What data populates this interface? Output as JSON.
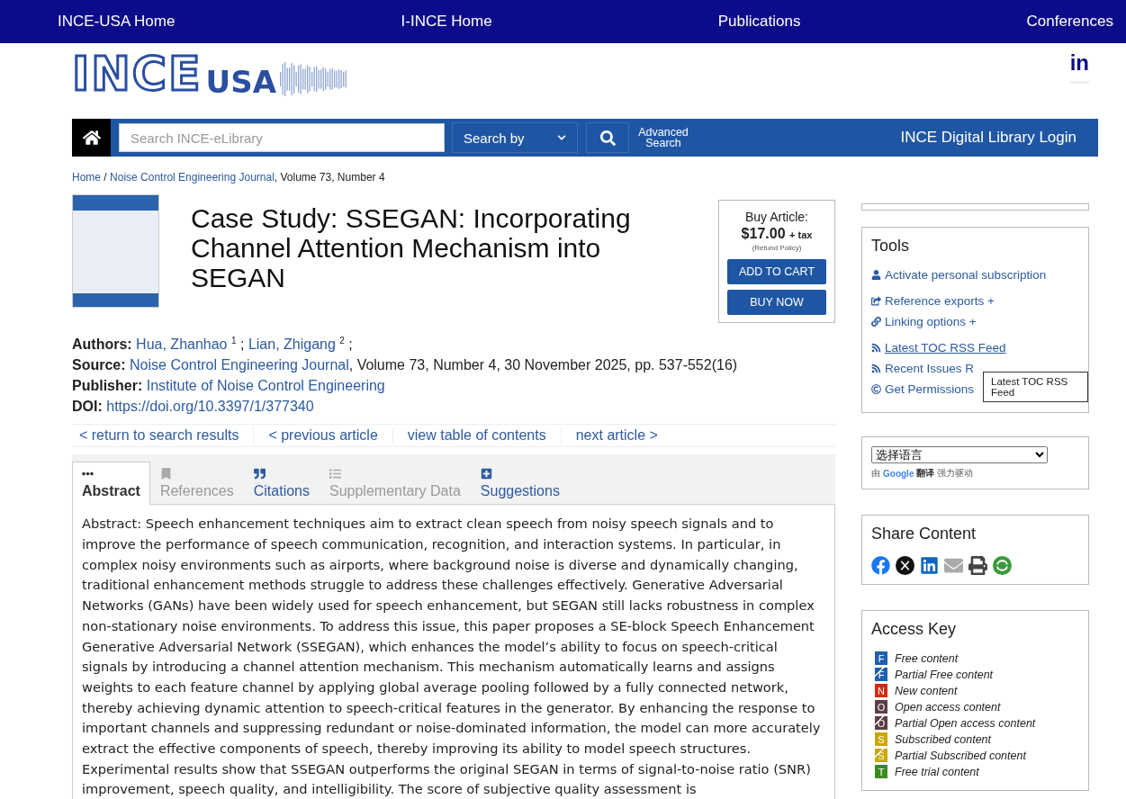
{
  "top_nav": [
    {
      "label": "INCE-USA Home"
    },
    {
      "label": "I-INCE Home"
    },
    {
      "label": "Publications"
    },
    {
      "label": "Conferences"
    }
  ],
  "logo": {
    "main": "INCE",
    "suffix": "USA"
  },
  "social_link": {
    "label": "in"
  },
  "search_bar": {
    "placeholder": "Search INCE-eLibrary",
    "search_by": "Search by",
    "advanced": "Advanced Search",
    "login": "INCE Digital Library Login"
  },
  "breadcrumb": {
    "home": "Home",
    "separator": "/",
    "journal": "Noise Control Engineering Journal",
    "rest": ", Volume 73, Number 4"
  },
  "article": {
    "title": "Case Study: SSEGAN: Incorporating Channel Attention Mechanism into SEGAN",
    "meta": [
      {
        "kind": "authors",
        "label": "Authors:",
        "parts": [
          {
            "text": "Hua, Zhanhao",
            "sup": "1"
          },
          {
            "text": "Lian, Zhigang",
            "sup": "2"
          }
        ],
        "tail": ";"
      },
      {
        "kind": "link",
        "label": "Source:",
        "link": "Noise Control Engineering Journal",
        "rest": ", Volume 73, Number 4, 30 November 2025, pp. 537-552(16)"
      },
      {
        "kind": "link",
        "label": "Publisher:",
        "link": "Institute of Noise Control Engineering"
      },
      {
        "kind": "link",
        "label": "DOI:",
        "link": "https://doi.org/10.3397/1/377340"
      }
    ]
  },
  "buy_box": {
    "title": "Buy Article:",
    "price": "$17.00",
    "tax": "+ tax",
    "refund": "(Refund Policy)",
    "buttons": [
      "ADD TO CART",
      "BUY NOW"
    ]
  },
  "article_nav": [
    {
      "label": "< return to search results"
    },
    {
      "label": "< previous article"
    },
    {
      "label": "view table of contents"
    },
    {
      "label": "next article >"
    }
  ],
  "tabs": [
    {
      "kind": "dots",
      "label": "Abstract",
      "selected": true,
      "disabled": false
    },
    {
      "kind": "bookmark",
      "label": "References",
      "selected": false,
      "disabled": true
    },
    {
      "kind": "quote",
      "label": "Citations",
      "selected": false,
      "disabled": false
    },
    {
      "kind": "list",
      "label": "Supplementary Data",
      "selected": false,
      "disabled": true
    },
    {
      "kind": "plus",
      "label": "Suggestions",
      "selected": false,
      "disabled": false
    }
  ],
  "abstract": "Abstract: Speech enhancement techniques aim to extract clean speech from noisy speech signals and to improve the performance of speech communication, recognition, and interaction systems. In particular, in complex noisy environments such as airports, where background noise is diverse and dynamically changing, traditional enhancement methods struggle to address these challenges effectively. Generative Adversarial Networks (GANs) have been widely used for speech enhancement, but SEGAN still lacks robustness in complex non-stationary noise environments. To address this issue, this paper proposes a SE-block Speech Enhancement Generative Adversarial Network (SSEGAN), which enhances the model’s ability to focus on speech-critical signals by introducing a channel attention mechanism. This mechanism automatically learns and assigns weights to each feature channel by applying global average pooling followed by a fully connected network, thereby achieving dynamic attention to speech-critical features in the generator. By enhancing the response to important channels and suppressing redundant or noise-dominated information, the model can more accurately extract the effective components of speech, thereby improving its ability to model speech structures. Experimental results show that SSEGAN outperforms the original SEGAN in terms of signal-to-noise ratio (SNR) improvement, speech quality, and intelligibility. The score of subjective quality assessment is",
  "tools": {
    "title": "Tools",
    "items": [
      {
        "kind": "user",
        "label": "Activate personal subscription",
        "underlined": false
      },
      {
        "kind": "export",
        "label": "Reference exports +",
        "underlined": false
      },
      {
        "kind": "link",
        "label": "Linking options +",
        "underlined": false
      },
      {
        "kind": "rss",
        "label": "Latest TOC RSS Feed",
        "underlined": true
      },
      {
        "kind": "rss",
        "label": "Recent Issues R",
        "underlined": false
      },
      {
        "kind": "copyright",
        "label": "Get Permissions",
        "underlined": false
      }
    ],
    "tooltip": "Latest TOC RSS Feed"
  },
  "translate": {
    "select": "选择语言",
    "by": "由",
    "brand": "Google",
    "service": "翻译",
    "powered": "强力驱动"
  },
  "share": {
    "title": "Share Content"
  },
  "access_key": {
    "title": "Access Key",
    "items": [
      {
        "letter": "F",
        "label": "Free content",
        "color": "#1f5fae",
        "kind": "full"
      },
      {
        "letter": "F",
        "label": "Partial Free content",
        "color": "#1f5fae",
        "kind": "partial"
      },
      {
        "letter": "N",
        "label": "New content",
        "color": "#d42a10",
        "kind": "full"
      },
      {
        "letter": "O",
        "label": "Open access content",
        "color": "#5a3e4a",
        "kind": "full"
      },
      {
        "letter": "O",
        "label": "Partial Open access content",
        "color": "#5a3e4a",
        "kind": "partial"
      },
      {
        "letter": "S",
        "label": "Subscribed content",
        "color": "#c9a800",
        "kind": "full"
      },
      {
        "letter": "S",
        "label": "Partial Subscribed content",
        "color": "#c9a800",
        "kind": "partial"
      },
      {
        "letter": "T",
        "label": "Free trial content",
        "color": "#3c8a1c",
        "kind": "full"
      }
    ]
  }
}
